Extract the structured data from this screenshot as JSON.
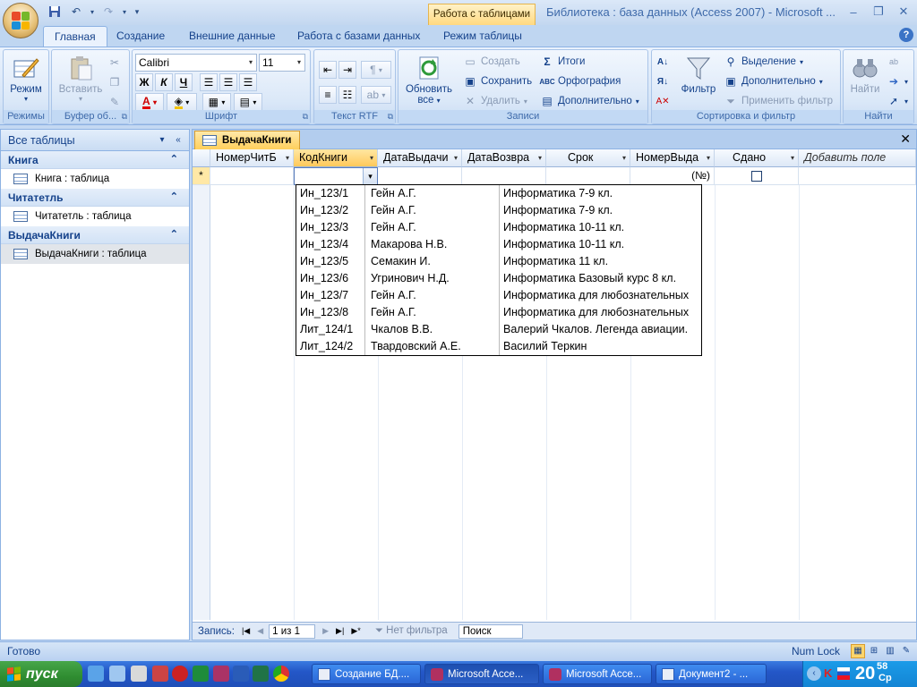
{
  "window": {
    "contextual_group": "Работа с таблицами",
    "title": "Библиотека : база данных (Access 2007) - Microsoft ..."
  },
  "tabs": [
    "Главная",
    "Создание",
    "Внешние данные",
    "Работа с базами данных",
    "Режим таблицы"
  ],
  "ribbon": {
    "views": {
      "button": "Режим",
      "group": "Режимы"
    },
    "clipboard": {
      "paste": "Вставить",
      "group": "Буфер об..."
    },
    "font": {
      "name": "Calibri",
      "size": "11",
      "bold": "Ж",
      "italic": "К",
      "underline": "Ч",
      "group": "Шрифт"
    },
    "rtf": {
      "group": "Текст RTF"
    },
    "records": {
      "refresh": "Обновить",
      "refresh_sub": "все",
      "new": "Создать",
      "save": "Сохранить",
      "delete": "Удалить",
      "totals": "Итоги",
      "spelling": "Орфография",
      "more": "Дополнительно",
      "group": "Записи"
    },
    "sort": {
      "filter": "Фильтр",
      "selection": "Выделение",
      "advanced": "Дополнительно",
      "toggle": "Применить фильтр",
      "group": "Сортировка и фильтр"
    },
    "find": {
      "find": "Найти",
      "group": "Найти"
    }
  },
  "nav": {
    "header": "Все таблицы",
    "groups": [
      {
        "title": "Книга",
        "item": "Книга : таблица"
      },
      {
        "title": "Читатетль",
        "item": "Читатетль : таблица"
      },
      {
        "title": "ВыдачаКниги",
        "item": "ВыдачаКниги : таблица"
      }
    ]
  },
  "document": {
    "tab": "ВыдачаКниги",
    "columns": [
      "НомерЧитБ",
      "КодКниги",
      "ДатаВыдачи",
      "ДатаВозвра",
      "Срок",
      "НомерВыда",
      "Сдано",
      "Добавить поле"
    ],
    "new_row_marker": "*",
    "autonumber": "(№)",
    "dropdown_rows": [
      [
        "Ин_123/1",
        "Гейн А.Г.",
        "Информатика 7-9 кл."
      ],
      [
        "Ин_123/2",
        "Гейн А.Г.",
        "Информатика 7-9 кл."
      ],
      [
        "Ин_123/3",
        "Гейн А.Г.",
        "Информатика 10-11 кл."
      ],
      [
        "Ин_123/4",
        "Макарова Н.В.",
        "Информатика 10-11 кл."
      ],
      [
        "Ин_123/5",
        "Семакин И.",
        "Информатика 11 кл."
      ],
      [
        "Ин_123/6",
        "Угринович Н.Д.",
        "Информатика Базовый курс 8 кл."
      ],
      [
        "Ин_123/7",
        "Гейн А.Г.",
        "Информатика для любознательных"
      ],
      [
        "Ин_123/8",
        "Гейн А.Г.",
        "Информатика для любознательных"
      ],
      [
        "Лит_124/1",
        "Чкалов В.В.",
        "Валерий Чкалов. Легенда авиации."
      ],
      [
        "Лит_124/2",
        "Твардовский А.Е.",
        "Василий Теркин"
      ]
    ],
    "record_nav": {
      "label": "Запись:",
      "position": "1 из 1",
      "filter": "Нет фильтра",
      "search": "Поиск"
    }
  },
  "status": {
    "left": "Готово",
    "numlock": "Num Lock"
  },
  "taskbar": {
    "start": "пуск",
    "buttons": [
      "Создание БД....",
      "Microsoft Acce...",
      "Microsoft Acce...",
      "Документ2 - ..."
    ],
    "time_hour": "20",
    "time_min": "58",
    "day": "Ср"
  }
}
